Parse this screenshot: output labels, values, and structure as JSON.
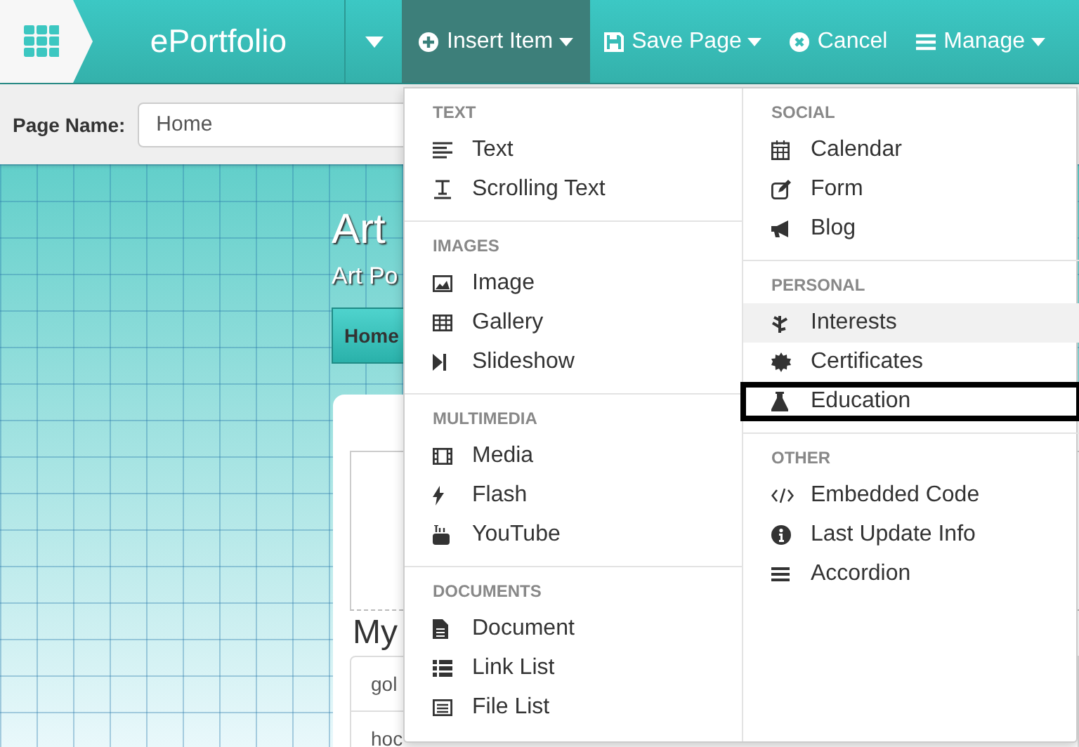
{
  "app": {
    "title": "ePortfolio"
  },
  "toolbar": [
    {
      "label": "Insert Item",
      "selected": true,
      "caret": true
    },
    {
      "label": "Save Page",
      "selected": false,
      "caret": true
    },
    {
      "label": "Cancel",
      "selected": false,
      "caret": false
    },
    {
      "label": "Manage",
      "selected": false,
      "caret": true
    }
  ],
  "page_name": {
    "label": "Page Name:",
    "value": "Home"
  },
  "site": {
    "title": "Art",
    "subtitle": "Art Po",
    "nav": [
      {
        "label": "Home"
      }
    ],
    "heading": "My",
    "rows": [
      "gol",
      "hoc"
    ]
  },
  "insert_menu": {
    "columns": [
      [
        {
          "header": "TEXT",
          "items": [
            {
              "label": "Text",
              "selected": false,
              "outlined": false
            },
            {
              "label": "Scrolling Text",
              "selected": false,
              "outlined": false
            }
          ]
        },
        {
          "header": "IMAGES",
          "items": [
            {
              "label": "Image",
              "selected": false,
              "outlined": false
            },
            {
              "label": "Gallery",
              "selected": false,
              "outlined": false
            },
            {
              "label": "Slideshow",
              "selected": false,
              "outlined": false
            }
          ]
        },
        {
          "header": "MULTIMEDIA",
          "items": [
            {
              "label": "Media",
              "selected": false,
              "outlined": false
            },
            {
              "label": "Flash",
              "selected": false,
              "outlined": false
            },
            {
              "label": "YouTube",
              "selected": false,
              "outlined": false
            }
          ]
        },
        {
          "header": "DOCUMENTS",
          "items": [
            {
              "label": "Document",
              "selected": false,
              "outlined": false
            },
            {
              "label": "Link List",
              "selected": false,
              "outlined": false
            },
            {
              "label": "File List",
              "selected": false,
              "outlined": false
            }
          ]
        }
      ],
      [
        {
          "header": "SOCIAL",
          "items": [
            {
              "label": "Calendar",
              "selected": false,
              "outlined": false
            },
            {
              "label": "Form",
              "selected": false,
              "outlined": false
            },
            {
              "label": "Blog",
              "selected": false,
              "outlined": false
            }
          ]
        },
        {
          "header": "PERSONAL",
          "items": [
            {
              "label": "Interests",
              "selected": true,
              "outlined": false
            },
            {
              "label": "Certificates",
              "selected": false,
              "outlined": false
            },
            {
              "label": "Education",
              "selected": false,
              "outlined": true
            }
          ]
        },
        {
          "header": "OTHER",
          "items": [
            {
              "label": "Embedded Code",
              "selected": false,
              "outlined": false
            },
            {
              "label": "Last Update Info",
              "selected": false,
              "outlined": false
            },
            {
              "label": "Accordion",
              "selected": false,
              "outlined": false
            }
          ]
        }
      ]
    ]
  }
}
